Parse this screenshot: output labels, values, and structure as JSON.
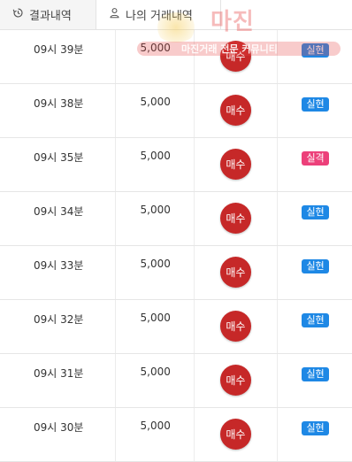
{
  "tabs": [
    {
      "label": "결과내역",
      "icon": "history-icon"
    },
    {
      "label": "나의 거래내역",
      "icon": "user-icon"
    }
  ],
  "watermark": {
    "logo": "마진",
    "tagline": "마진거래 전문 커뮤니티"
  },
  "colors": {
    "buy": "#c62828",
    "hit": "#1e88e5",
    "miss": "#ec407a"
  },
  "rows": [
    {
      "time": "09시 39분",
      "amount": "5,000",
      "action": "매수",
      "result": "실현",
      "type": "hit"
    },
    {
      "time": "09시 38분",
      "amount": "5,000",
      "action": "매수",
      "result": "실현",
      "type": "hit"
    },
    {
      "time": "09시 35분",
      "amount": "5,000",
      "action": "매수",
      "result": "실격",
      "type": "miss"
    },
    {
      "time": "09시 34분",
      "amount": "5,000",
      "action": "매수",
      "result": "실현",
      "type": "hit"
    },
    {
      "time": "09시 33분",
      "amount": "5,000",
      "action": "매수",
      "result": "실현",
      "type": "hit"
    },
    {
      "time": "09시 32분",
      "amount": "5,000",
      "action": "매수",
      "result": "실현",
      "type": "hit"
    },
    {
      "time": "09시 31분",
      "amount": "5,000",
      "action": "매수",
      "result": "실현",
      "type": "hit"
    },
    {
      "time": "09시 30분",
      "amount": "5,000",
      "action": "매수",
      "result": "실현",
      "type": "hit"
    }
  ]
}
